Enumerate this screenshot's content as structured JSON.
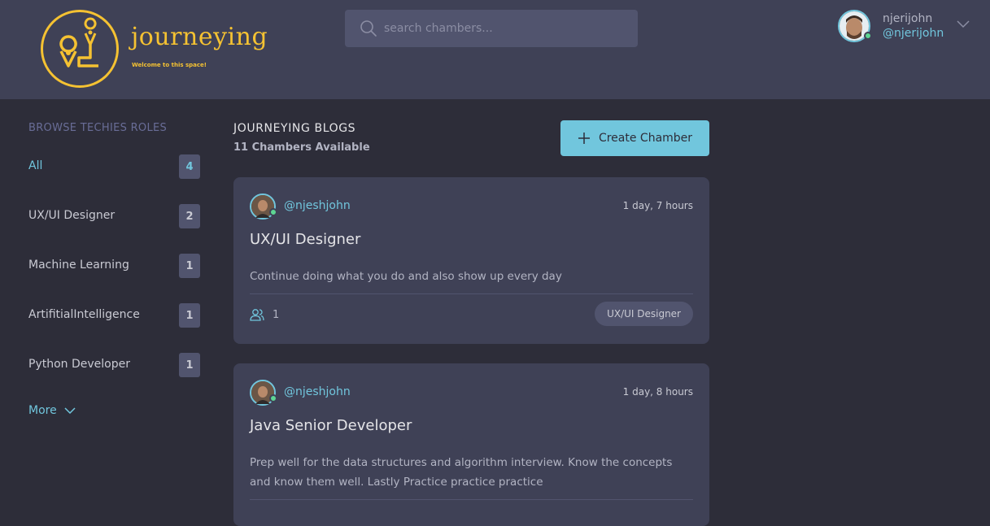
{
  "brand": {
    "name": "journeying",
    "tagline": "Welcome to this space!"
  },
  "search": {
    "placeholder": "search chambers..."
  },
  "user": {
    "name": "njerijohn",
    "handle": "@njerijohn"
  },
  "sidebar": {
    "title": "BROWSE TECHIES ROLES",
    "roles": [
      {
        "label": "All",
        "count": "4"
      },
      {
        "label": "UX/UI Designer",
        "count": "2"
      },
      {
        "label": "Machine Learning",
        "count": "1"
      },
      {
        "label": "ArtifitialIntelligence",
        "count": "1"
      },
      {
        "label": "Python Developer",
        "count": "1"
      }
    ],
    "more_label": "More"
  },
  "main": {
    "title": "JOURNEYING BLOGS",
    "subtitle": "11 Chambers Available",
    "create_label": "Create Chamber"
  },
  "posts": [
    {
      "handle": "@njeshjohn",
      "time": "1 day, 7 hours",
      "title": "UX/UI Designer",
      "body": "Continue doing what you do and also show up every day",
      "members": "1",
      "tag": "UX/UI Designer"
    },
    {
      "handle": "@njeshjohn",
      "time": "1 day, 8 hours",
      "title": "Java Senior Developer",
      "body": "Prep well for the data structures and algorithm interview. Know the concepts and know them well. Lastly Practice practice practice"
    }
  ],
  "colors": {
    "accent": "#71c6dd",
    "brand": "#f5c232",
    "online": "#5dd693",
    "header_bg": "#3f4156",
    "page_bg": "#2d2d39"
  }
}
